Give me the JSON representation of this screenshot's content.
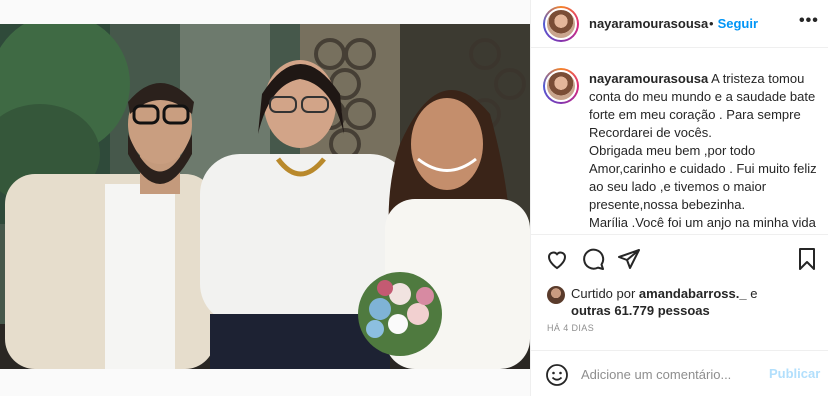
{
  "post": {
    "author": "nayaramourasousa",
    "follow_label": "Seguir",
    "separator": "•",
    "more_label": "•••",
    "caption": {
      "username": "nayaramourasousa",
      "text": " A tristeza tomou conta do meu mundo e a saudade bate forte em meu coração . Para sempre Recordarei de vocês.\nObrigada meu bem ,por todo Amor,carinho e cuidado . Fui muito feliz ao seu lado ,e tivemos o maior presente,nossa bebezinha.\nMarília .Você foi um anjo na minha vida e de todos a sua volta . Obrigada por me"
    },
    "likes": {
      "prefix": "Curtido por ",
      "liker": "amandabarross._",
      "middle": " e",
      "others": "outras 61.779 pessoas"
    },
    "timestamp": "HÁ 4 DIAS",
    "comment": {
      "placeholder": "Adicione um comentário...",
      "publish_label": "Publicar"
    }
  },
  "icons": {
    "like": "heart-icon",
    "comment": "comment-icon",
    "share": "send-icon",
    "save": "bookmark-icon",
    "emoji": "smiley-icon",
    "more": "more-options-icon"
  },
  "colors": {
    "link_blue": "#0095f6",
    "publish_disabled": "#b2dffc",
    "muted": "#8e8e8e",
    "text": "#262626"
  }
}
